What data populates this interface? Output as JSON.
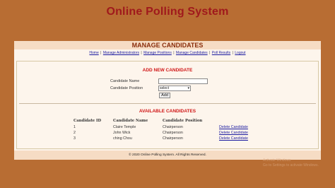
{
  "site": {
    "title": "Online Polling System"
  },
  "page": {
    "heading": "MANAGE CANDIDATES"
  },
  "nav": {
    "items": [
      "Home",
      "Manage Administrators",
      "Manage Positions",
      "Manage Candidates",
      "Poll Results",
      "Logout"
    ],
    "separator": "|"
  },
  "add_form": {
    "title": "ADD NEW CANDIDATE",
    "name_label": "Candidate Name",
    "name_value": "",
    "position_label": "Candidate Position",
    "position_selected": "select",
    "add_label": "Add"
  },
  "candidates": {
    "title": "AVAILABLE CANDIDATES",
    "columns": [
      "Candidate ID",
      "Candidate Name",
      "Candidate Position",
      ""
    ],
    "delete_label": "Delete Candidate",
    "rows": [
      {
        "id": "1",
        "name": "Claire Temple",
        "position": "Chairperson"
      },
      {
        "id": "2",
        "name": "John Wick",
        "position": "Chairperson"
      },
      {
        "id": "3",
        "name": "ching Chou",
        "position": "Chairperson"
      }
    ]
  },
  "footer": {
    "text": "© 2020 Online Polling System. All Rights Reserved."
  },
  "watermark": {
    "line1": "Activate Windows",
    "line2": "Go to Settings to activate Windows."
  },
  "colors": {
    "background": "#b86d33",
    "title": "#a0191c",
    "section_title": "#d01515",
    "link": "#1a1aa0",
    "header_bar": "#f6dcc4"
  }
}
